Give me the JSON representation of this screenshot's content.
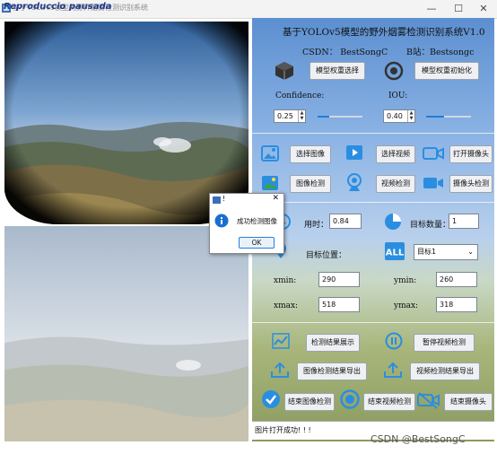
{
  "window": {
    "title": "基于YOLOv5模型的野外烟雾检测识别系统",
    "overlay_title": "Reproduccio pausada",
    "minimize": "—",
    "maximize": "☐",
    "close": "✕"
  },
  "header": {
    "title": "基于YOLOv5模型的野外烟雾检测识别系统V1.0",
    "csdn": "CSDN： BestSongC",
    "bili": "B站：Bestsongc"
  },
  "model": {
    "select_label": "模型权重选择",
    "init_label": "模型权重初始化"
  },
  "params": {
    "confidence_label": "Confidence:",
    "confidence_value": "0.25",
    "confidence_level": 0.25,
    "iou_label": "IOU:",
    "iou_value": "0.40",
    "iou_level": 0.4
  },
  "buttons": {
    "select_image": "选择图像",
    "select_video": "选择视频",
    "open_camera": "打开摄像头",
    "image_detect": "图像检测",
    "video_detect": "视频检测",
    "camera_detect": "摄像头检测"
  },
  "results": {
    "time_label": "用时：",
    "time_value": "0.84",
    "count_label": "目标数量：",
    "count_value": "1",
    "position_label": "目标位置：",
    "target_select": "目标1",
    "xmin_label": "xmin:",
    "xmin_value": "290",
    "ymin_label": "ymin:",
    "ymin_value": "260",
    "xmax_label": "xmax:",
    "xmax_value": "518",
    "ymax_label": "ymax:",
    "ymax_value": "318"
  },
  "actions": {
    "show_results": "检测结果展示",
    "pause_video": "暂停视频检测",
    "export_image": "图像检测结果导出",
    "export_video": "视频检测结果导出",
    "end_image": "结束图像检测",
    "end_video": "结束视频检测",
    "end_camera": "结束摄像头"
  },
  "dialog": {
    "title": "!",
    "message": "成功检测图像",
    "ok": "OK",
    "close": "✕"
  },
  "status_bar": {
    "text": "图片打开成功! ! !"
  },
  "watermark": "CSDN @BestSongC",
  "colors": {
    "accent": "#1e7fd8",
    "icon_blue": "#2a8ee0",
    "dark_icon": "#333333"
  }
}
